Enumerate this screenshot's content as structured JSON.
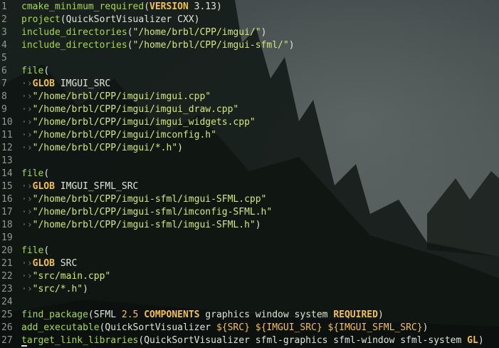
{
  "editor": {
    "lines": [
      {
        "num": "1",
        "tokens": [
          {
            "t": "cmake_minimum_required",
            "c": "fn"
          },
          {
            "t": "(",
            "c": "plain"
          },
          {
            "t": "VERSION",
            "c": "kw"
          },
          {
            "t": " 3.13)",
            "c": "plain"
          }
        ]
      },
      {
        "num": "2",
        "tokens": [
          {
            "t": "project",
            "c": "fn"
          },
          {
            "t": "(QuickSortVisualizer CXX)",
            "c": "plain"
          }
        ]
      },
      {
        "num": "3",
        "tokens": [
          {
            "t": "include_directories",
            "c": "fn"
          },
          {
            "t": "(",
            "c": "plain"
          },
          {
            "t": "\"/home/brbl/CPP/imgui/\"",
            "c": "str"
          },
          {
            "t": ")",
            "c": "plain"
          }
        ]
      },
      {
        "num": "4",
        "tokens": [
          {
            "t": "include_directories",
            "c": "fn"
          },
          {
            "t": "(",
            "c": "plain"
          },
          {
            "t": "\"/home/brbl/CPP/imgui-sfml/\"",
            "c": "str"
          },
          {
            "t": ")",
            "c": "plain"
          }
        ]
      },
      {
        "num": "5",
        "tokens": []
      },
      {
        "num": "6",
        "tokens": [
          {
            "t": "file",
            "c": "fn"
          },
          {
            "t": "(",
            "c": "plain"
          }
        ]
      },
      {
        "num": "7",
        "tokens": [
          {
            "t": "·›",
            "c": "ws"
          },
          {
            "t": "GLOB",
            "c": "kw"
          },
          {
            "t": " IMGUI_SRC",
            "c": "plain"
          }
        ]
      },
      {
        "num": "8",
        "tokens": [
          {
            "t": "·›",
            "c": "ws"
          },
          {
            "t": "\"/home/brbl/CPP/imgui/imgui.cpp\"",
            "c": "str"
          }
        ]
      },
      {
        "num": "9",
        "tokens": [
          {
            "t": "·›",
            "c": "ws"
          },
          {
            "t": "\"/home/brbl/CPP/imgui/imgui_draw.cpp\"",
            "c": "str"
          }
        ]
      },
      {
        "num": "10",
        "tokens": [
          {
            "t": "·›",
            "c": "ws"
          },
          {
            "t": "\"/home/brbl/CPP/imgui/imgui_widgets.cpp\"",
            "c": "str"
          }
        ]
      },
      {
        "num": "11",
        "tokens": [
          {
            "t": "·›",
            "c": "ws"
          },
          {
            "t": "\"/home/brbl/CPP/imgui/imconfig.h\"",
            "c": "str"
          }
        ]
      },
      {
        "num": "12",
        "tokens": [
          {
            "t": "·›",
            "c": "ws"
          },
          {
            "t": "\"/home/brbl/CPP/imgui/*.h\"",
            "c": "str"
          },
          {
            "t": ")",
            "c": "plain"
          }
        ]
      },
      {
        "num": "13",
        "tokens": []
      },
      {
        "num": "14",
        "tokens": [
          {
            "t": "file",
            "c": "fn"
          },
          {
            "t": "(",
            "c": "plain"
          }
        ]
      },
      {
        "num": "15",
        "tokens": [
          {
            "t": "·›",
            "c": "ws"
          },
          {
            "t": "GLOB",
            "c": "kw"
          },
          {
            "t": " IMGUI_SFML_SRC",
            "c": "plain"
          }
        ]
      },
      {
        "num": "16",
        "tokens": [
          {
            "t": "·›",
            "c": "ws"
          },
          {
            "t": "\"/home/brbl/CPP/imgui-sfml/imgui-SFML.cpp\"",
            "c": "str"
          }
        ]
      },
      {
        "num": "17",
        "tokens": [
          {
            "t": "·›",
            "c": "ws"
          },
          {
            "t": "\"/home/brbl/CPP/imgui-sfml/imconfig-SFML.h\"",
            "c": "str"
          }
        ]
      },
      {
        "num": "18",
        "tokens": [
          {
            "t": "·›",
            "c": "ws"
          },
          {
            "t": "\"/home/brbl/CPP/imgui-sfml/imgui-SFML.h\"",
            "c": "str"
          },
          {
            "t": ")",
            "c": "plain"
          }
        ]
      },
      {
        "num": "19",
        "tokens": []
      },
      {
        "num": "20",
        "tokens": [
          {
            "t": "file",
            "c": "fn"
          },
          {
            "t": "(",
            "c": "plain"
          }
        ]
      },
      {
        "num": "21",
        "tokens": [
          {
            "t": "·›",
            "c": "ws"
          },
          {
            "t": "GLOB",
            "c": "kw"
          },
          {
            "t": " SRC",
            "c": "plain"
          }
        ]
      },
      {
        "num": "22",
        "tokens": [
          {
            "t": "·›",
            "c": "ws"
          },
          {
            "t": "\"src/main.cpp\"",
            "c": "str"
          }
        ]
      },
      {
        "num": "23",
        "tokens": [
          {
            "t": "·›",
            "c": "ws"
          },
          {
            "t": "\"src/*.h\"",
            "c": "str"
          },
          {
            "t": ")",
            "c": "plain"
          }
        ]
      },
      {
        "num": "24",
        "tokens": []
      },
      {
        "num": "25",
        "tokens": [
          {
            "t": "find_package",
            "c": "fn"
          },
          {
            "t": "(SFML ",
            "c": "plain"
          },
          {
            "t": "2.5",
            "c": "num"
          },
          {
            "t": " ",
            "c": "plain"
          },
          {
            "t": "COMPONENTS",
            "c": "kw"
          },
          {
            "t": " graphics window system ",
            "c": "plain"
          },
          {
            "t": "REQUIRED",
            "c": "kw"
          },
          {
            "t": ")",
            "c": "plain"
          }
        ]
      },
      {
        "num": "26",
        "tokens": [
          {
            "t": "add_executable",
            "c": "fn"
          },
          {
            "t": "(QuickSortVisualizer ",
            "c": "plain"
          },
          {
            "t": "${SRC}",
            "c": "var"
          },
          {
            "t": " ",
            "c": "plain"
          },
          {
            "t": "${IMGUI_SRC}",
            "c": "var"
          },
          {
            "t": " ",
            "c": "plain"
          },
          {
            "t": "${IMGUI_SFML_SRC}",
            "c": "var"
          },
          {
            "t": ")",
            "c": "plain"
          }
        ]
      },
      {
        "num": "27",
        "tokens": [
          {
            "t": "target_link_libraries",
            "c": "fn"
          },
          {
            "t": "(QuickSortVisualizer sfml-graphics sfml-window sfml-system ",
            "c": "plain"
          },
          {
            "t": "GL",
            "c": "kw"
          },
          {
            "t": ")",
            "c": "plain"
          }
        ]
      }
    ]
  },
  "colors": {
    "function": "#a6d94a",
    "keyword": "#f2c14d",
    "string": "#d3e77a",
    "plain": "#dfe4da",
    "line_number": "#8f9b90",
    "whitespace_marker": "#6f7b70",
    "background": "#1b2320"
  }
}
